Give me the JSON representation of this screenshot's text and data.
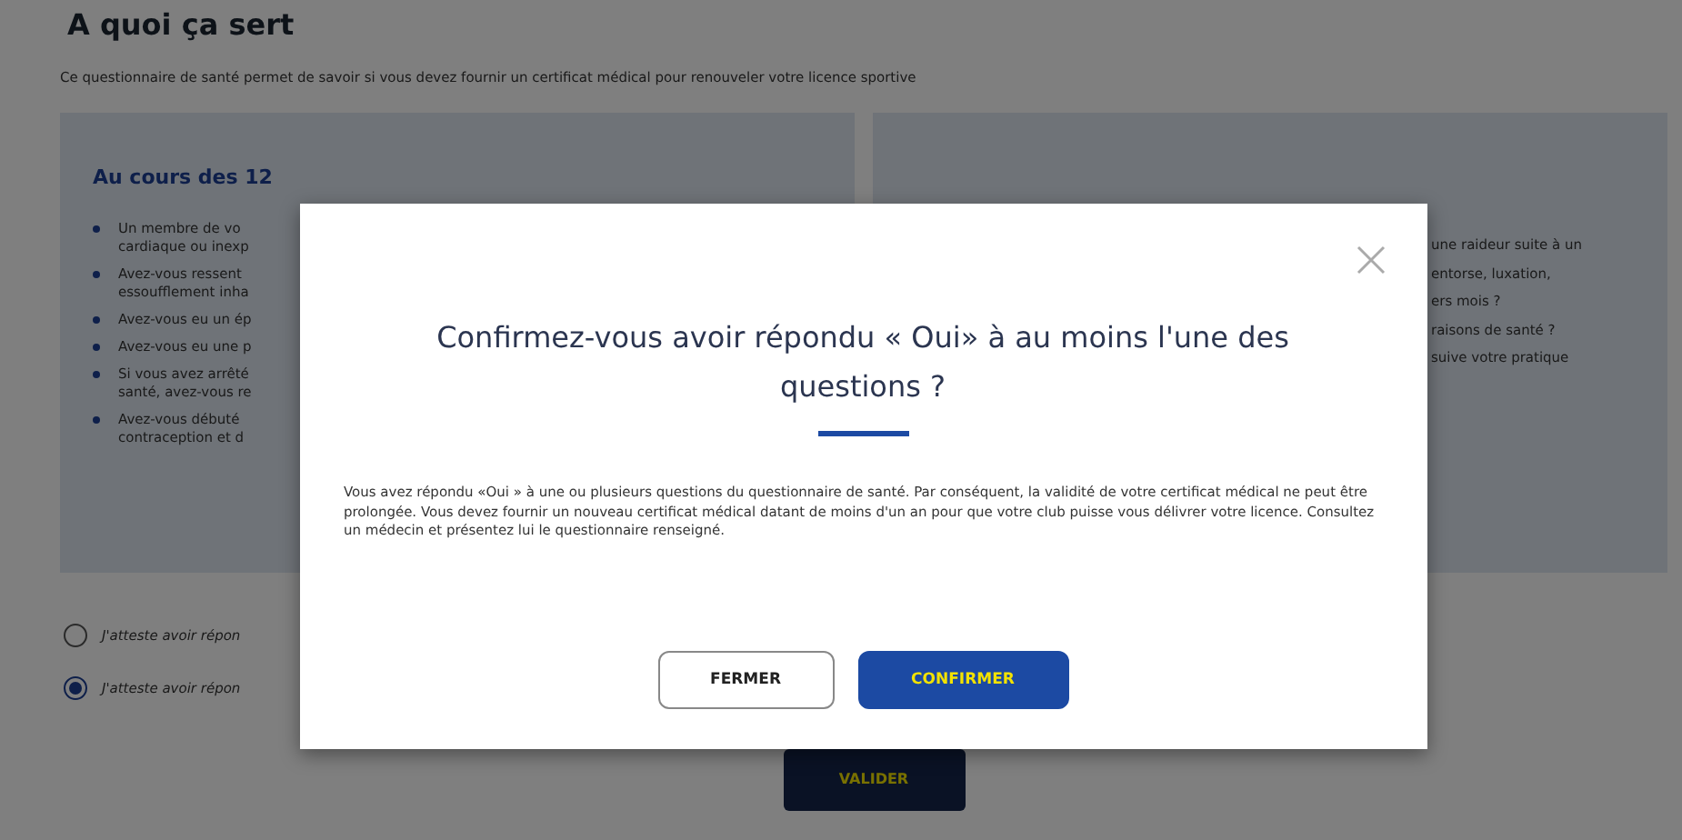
{
  "page": {
    "title": "A quoi ça sert",
    "intro": "Ce questionnaire de santé permet de savoir si vous devez fournir un certificat médical pour renouveler votre licence sportive"
  },
  "panel": {
    "left_heading": "Au cours des 12",
    "left_items": [
      {
        "lines": [
          "Un membre de vo",
          "cardiaque ou inexp"
        ]
      },
      {
        "lines": [
          "Avez-vous ressent",
          "essoufflement inha"
        ]
      },
      {
        "lines": [
          "Avez-vous eu un ép"
        ]
      },
      {
        "lines": [
          "Avez-vous eu une p"
        ]
      },
      {
        "lines": [
          "Si vous avez arrêté",
          "santé, avez-vous re"
        ]
      },
      {
        "lines": [
          "Avez-vous débuté",
          "contraception et d"
        ]
      }
    ],
    "right_lines": [
      "une raideur suite à un",
      "entorse, luxation,",
      "ers mois ?",
      "raisons de santé ?",
      "suive votre pratique"
    ]
  },
  "options": [
    {
      "label": "J'atteste avoir répon",
      "selected": false
    },
    {
      "label": "J'atteste avoir répon",
      "selected": true
    }
  ],
  "validate_button": "VALIDER",
  "modal": {
    "title": "Confirmez-vous avoir répondu « Oui» à au moins l'une des questions ?",
    "body": "Vous avez répondu «Oui » à une ou plusieurs questions du questionnaire de santé. Par conséquent, la validité de votre certificat médical ne peut être prolongée. Vous devez fournir un nouveau certificat médical datant de moins d'un an pour que votre club puisse vous délivrer votre licence. Consultez un médecin et présentez lui le questionnaire renseigné.",
    "buttons": [
      {
        "label": "FERMER",
        "kind": "secondary"
      },
      {
        "label": "CONFIRMER",
        "kind": "primary"
      }
    ]
  }
}
